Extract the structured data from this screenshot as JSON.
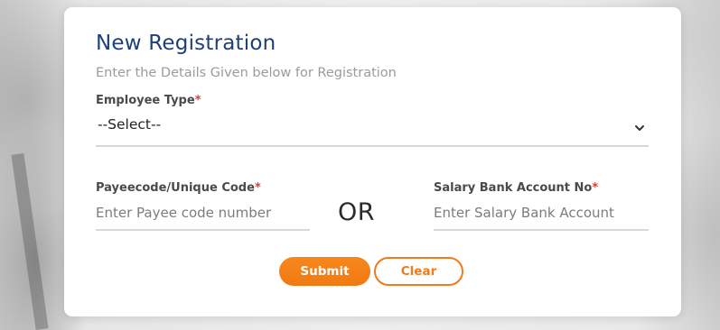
{
  "form": {
    "title": "New Registration",
    "subtitle": "Enter the Details Given below for Registration",
    "employee_type": {
      "label": "Employee Type",
      "required_mark": "*",
      "selected": "--Select--"
    },
    "payee_code": {
      "label": "Payeecode/Unique Code",
      "required_mark": "*",
      "value": "",
      "placeholder": "Enter Payee code number"
    },
    "separator": "OR",
    "salary_account": {
      "label": "Salary Bank Account No",
      "required_mark": "*",
      "value": "",
      "placeholder": "Enter Salary Bank Account"
    },
    "buttons": {
      "submit": "Submit",
      "clear": "Clear"
    }
  },
  "icons": {
    "select_arrow": "chevron-down-icon"
  },
  "colors": {
    "title": "#1f3f7a",
    "accent": "#f07a12",
    "required": "#e23b3b",
    "subtitle": "#9b9b9b"
  }
}
